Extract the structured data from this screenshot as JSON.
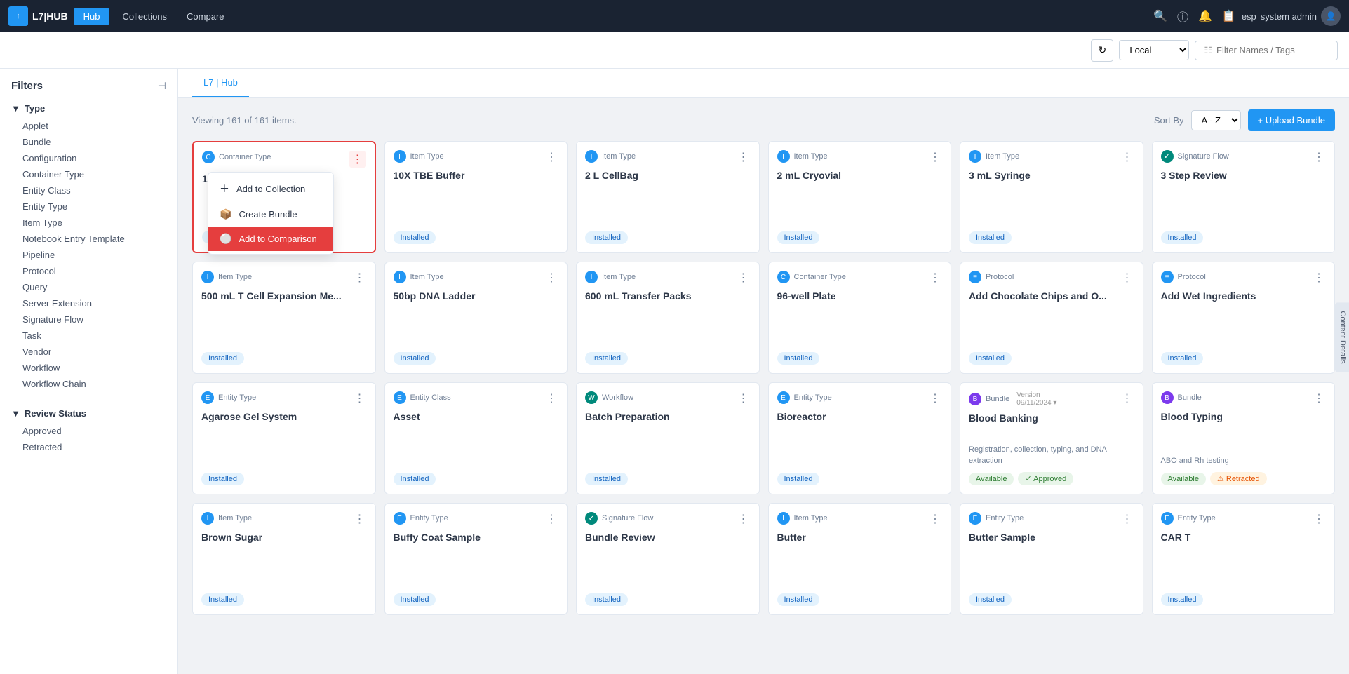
{
  "topnav": {
    "logo_text": "L7|HUB",
    "hub_btn": "Hub",
    "collections_link": "Collections",
    "compare_link": "Compare",
    "user_initials": "esp",
    "user_name": "system admin"
  },
  "toolbar": {
    "location_option": "Local",
    "filter_placeholder": "Filter Names / Tags"
  },
  "sidebar": {
    "title": "Filters",
    "collapse_icon": "⊣",
    "type_section": "Type",
    "type_items": [
      "Applet",
      "Bundle",
      "Configuration",
      "Container Type",
      "Entity Class",
      "Entity Type",
      "Item Type",
      "Notebook Entry Template",
      "Pipeline",
      "Protocol",
      "Query",
      "Server Extension",
      "Signature Flow",
      "Task",
      "Vendor",
      "Workflow",
      "Workflow Chain"
    ],
    "review_section": "Review Status",
    "review_items": [
      "Approved",
      "Retracted"
    ]
  },
  "content": {
    "tab": "L7 | Hub",
    "viewing_text": "Viewing 161 of 161 items.",
    "sort_label": "Sort By",
    "sort_option": "A - Z",
    "upload_btn": "+ Upload Bundle"
  },
  "dropdown": {
    "add_collection": "Add to Collection",
    "create_bundle": "Create Bundle",
    "add_comparison": "Add to Comparison"
  },
  "cards": [
    {
      "type": "Container Type",
      "icon_class": "icon-blue",
      "icon_letter": "C",
      "name": "1-D",
      "status": "Installed",
      "active": true,
      "show_dropdown": true
    },
    {
      "type": "Item Type",
      "icon_class": "icon-blue",
      "icon_letter": "I",
      "name": "10X TBE Buffer",
      "status": "Installed"
    },
    {
      "type": "Item Type",
      "icon_class": "icon-blue",
      "icon_letter": "I",
      "name": "2 L CellBag",
      "status": "Installed"
    },
    {
      "type": "Item Type",
      "icon_class": "icon-blue",
      "icon_letter": "I",
      "name": "2 mL Cryovial",
      "status": "Installed"
    },
    {
      "type": "Item Type",
      "icon_class": "icon-blue",
      "icon_letter": "I",
      "name": "3 mL Syringe",
      "status": "Installed"
    },
    {
      "type": "Signature Flow",
      "icon_class": "icon-teal",
      "icon_letter": "S",
      "name": "3 Step Review",
      "status": "Installed"
    },
    {
      "type": "Item Type",
      "icon_class": "icon-blue",
      "icon_letter": "I",
      "name": "500 mL T Cell Expansion Me...",
      "status": "Installed"
    },
    {
      "type": "Item Type",
      "icon_class": "icon-blue",
      "icon_letter": "I",
      "name": "50bp DNA Ladder",
      "status": "Installed"
    },
    {
      "type": "Item Type",
      "icon_class": "icon-blue",
      "icon_letter": "I",
      "name": "600 mL Transfer Packs",
      "status": "Installed"
    },
    {
      "type": "Container Type",
      "icon_class": "icon-blue",
      "icon_letter": "C",
      "name": "96-well Plate",
      "status": "Installed"
    },
    {
      "type": "Protocol",
      "icon_class": "icon-blue",
      "icon_letter": "≡",
      "name": "Add Chocolate Chips and O...",
      "status": "Installed"
    },
    {
      "type": "Protocol",
      "icon_class": "icon-blue",
      "icon_letter": "≡",
      "name": "Add Wet Ingredients",
      "status": "Installed"
    },
    {
      "type": "Entity Type",
      "icon_class": "icon-blue",
      "icon_letter": "E",
      "name": "Agarose Gel System",
      "status": "Installed"
    },
    {
      "type": "Entity Class",
      "icon_class": "icon-blue",
      "icon_letter": "E",
      "name": "Asset",
      "status": "Installed"
    },
    {
      "type": "Workflow",
      "icon_class": "icon-teal",
      "icon_letter": "W",
      "name": "Batch Preparation",
      "status": "Installed"
    },
    {
      "type": "Entity Type",
      "icon_class": "icon-blue",
      "icon_letter": "E",
      "name": "Bioreactor",
      "status": "Installed"
    },
    {
      "type": "Bundle",
      "icon_class": "icon-purple",
      "icon_letter": "B",
      "name": "Blood Banking",
      "desc": "Registration, collection, typing, and DNA extraction",
      "version": "09/11/2024",
      "status": "Available",
      "status2": "Approved"
    },
    {
      "type": "Bundle",
      "icon_class": "icon-purple",
      "icon_letter": "B",
      "name": "Blood Typing",
      "desc": "ABO and Rh testing",
      "status": "Available",
      "status2": "Retracted"
    },
    {
      "type": "Item Type",
      "icon_class": "icon-blue",
      "icon_letter": "I",
      "name": "Brown Sugar",
      "status": "Installed"
    },
    {
      "type": "Entity Type",
      "icon_class": "icon-blue",
      "icon_letter": "E",
      "name": "Buffy Coat Sample",
      "status": "Installed"
    },
    {
      "type": "Signature Flow",
      "icon_class": "icon-teal",
      "icon_letter": "S",
      "name": "Bundle Review",
      "status": "Installed"
    },
    {
      "type": "Item Type",
      "icon_class": "icon-blue",
      "icon_letter": "I",
      "name": "Butter",
      "status": "Installed"
    },
    {
      "type": "Entity Type",
      "icon_class": "icon-blue",
      "icon_letter": "E",
      "name": "Butter Sample",
      "status": "Installed"
    },
    {
      "type": "Entity Type",
      "icon_class": "icon-blue",
      "icon_letter": "E",
      "name": "CAR T",
      "status": "Installed"
    }
  ],
  "right_sidebar_label": "Content Details"
}
